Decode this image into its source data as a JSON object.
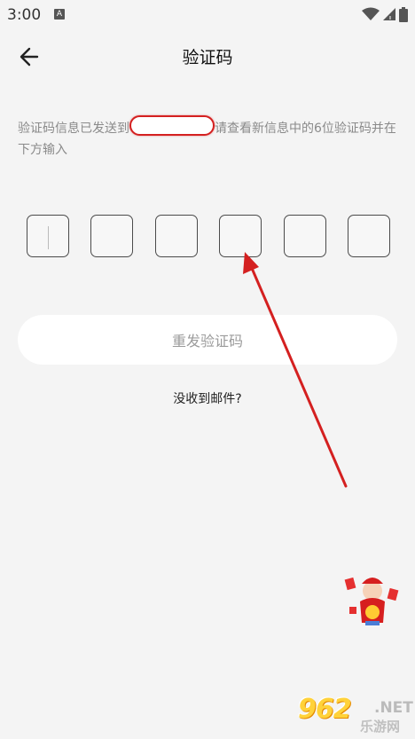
{
  "status_bar": {
    "time": "3:00",
    "a_icon": "A"
  },
  "header": {
    "title": "验证码"
  },
  "info": {
    "text_before": "验证码信息已发送到",
    "text_after": "请查看新信息中的6位验证码并在下方输入"
  },
  "code_input": {
    "digits": [
      "",
      "",
      "",
      "",
      "",
      ""
    ],
    "length": 6
  },
  "resend_button": {
    "label": "重发验证码"
  },
  "no_email_link": {
    "label": "没收到邮件?"
  },
  "watermark": {
    "logo": "962",
    "suffix": ".NET",
    "site_name": "乐游网"
  },
  "colors": {
    "background": "#f4f4f4",
    "annotation_red": "#d42020",
    "button_text": "#9b9b9b"
  }
}
